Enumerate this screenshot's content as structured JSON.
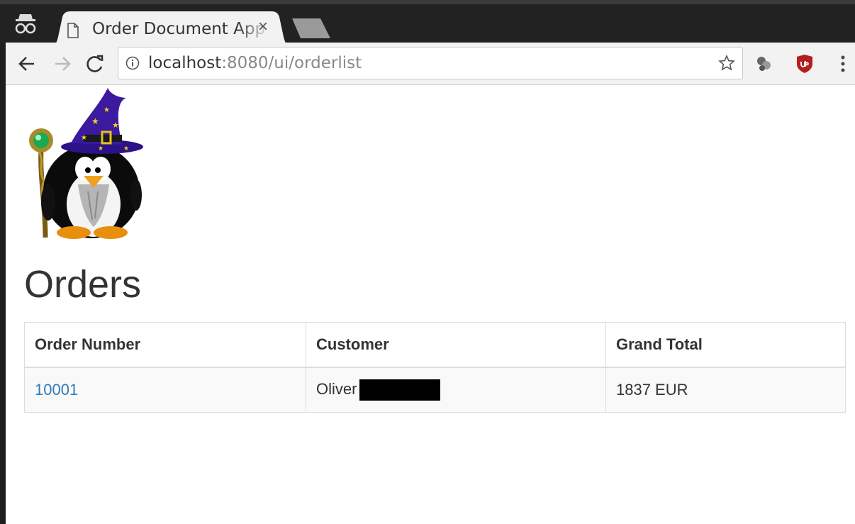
{
  "browser": {
    "tab": {
      "title": "Order Document App",
      "close_glyph": "×"
    },
    "toolbar": {
      "url_host": "localhost",
      "url_rest": ":8080/ui/orderlist",
      "back_glyph": "←",
      "forward_glyph": "→",
      "reload_glyph": "C"
    },
    "icons": {
      "incognito": "incognito-icon",
      "page": "page-icon",
      "info": "info-icon",
      "star": "bookmark-star-icon",
      "extension": "extension-icon",
      "ublock": "ublock-icon",
      "menu": "menu-dots-icon"
    }
  },
  "page": {
    "title": "Orders",
    "table": {
      "headers": [
        "Order Number",
        "Customer",
        "Grand Total"
      ],
      "rows": [
        {
          "order_number": "10001",
          "customer": "Oliver",
          "grand_total": "1837 EUR"
        }
      ]
    }
  },
  "colors": {
    "link": "#337ab7",
    "text": "#333333",
    "hat": "#3b1aa0",
    "ublock": "#b41e1e"
  }
}
